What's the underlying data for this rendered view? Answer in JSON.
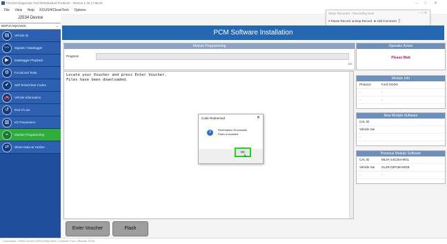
{
  "window": {
    "title": "KOUSH Diagnostic Tool Refurbished Products - Version 1.45.17.88.01"
  },
  "menu": [
    "File",
    "View",
    "Help",
    "KOUSH/CleanTech",
    "Options"
  ],
  "steps_recorder": {
    "title": "Steps Recorder - Recording Now",
    "pause": "Pause Record",
    "stop": "Stop Record",
    "add_comment": "Add Comment"
  },
  "sidebar": {
    "device_title": "J2534 Device",
    "device_select": "DDPort MyCANIC",
    "items": [
      {
        "label": "Vehicle ID",
        "icon": "vehicle-id-icon",
        "glyph": "▤"
      },
      {
        "label": "Signals / Datalogger",
        "icon": "signals-icon",
        "glyph": "〰"
      },
      {
        "label": "Datalogger Playback",
        "icon": "playback-icon",
        "glyph": "▶"
      },
      {
        "label": "Functional Tests",
        "icon": "functional-tests-icon",
        "glyph": "⚙"
      },
      {
        "label": "Self Tests/Clear Codes",
        "icon": "self-tests-icon",
        "glyph": "✔"
      },
      {
        "label": "Vehicle Information",
        "icon": "vehicle-info-icon",
        "glyph": "🚗"
      },
      {
        "label": "End of Line",
        "icon": "end-of-line-icon",
        "glyph": "↺"
      },
      {
        "label": "I/O Parameters",
        "icon": "io-parameters-icon",
        "glyph": "▥"
      },
      {
        "label": "Module Programming",
        "icon": "module-programming-icon",
        "glyph": "⌁",
        "active": true
      },
      {
        "label": "Share Data w/ Hotline",
        "icon": "share-data-icon",
        "glyph": "⇄"
      }
    ]
  },
  "header": {
    "title": "PCM Software Installation"
  },
  "module_programming": {
    "title": "Module Programming",
    "progress_label": "Progress",
    "progress_value": 0,
    "progress_text": "0/0"
  },
  "console": {
    "text": "Locate your Voucher and press Enter Voucher.\nFiles have been downloaded."
  },
  "buttons": {
    "enter_voucher": "Enter Voucher",
    "flash": "Flash"
  },
  "operator_action": {
    "title": "Operator Action",
    "status": "Please Wait"
  },
  "module_info": {
    "title": "Module Info",
    "rows": [
      {
        "key": "Protocol",
        "value": "Ford GGDS"
      },
      {
        "key": "-",
        "value": "-"
      },
      {
        "key": "-",
        "value": "-"
      }
    ]
  },
  "new_module_software": {
    "title": "New Module Software",
    "rows": [
      {
        "key": "CAL ID",
        "value": ""
      },
      {
        "key": "Vehicle Sw",
        "value": ""
      },
      {
        "key": "-",
        "value": ""
      }
    ]
  },
  "previous_module_software": {
    "title": "Previous Module Software",
    "rows": [
      {
        "key": "CAL ID",
        "value": "ML3A-14C204-MGL"
      },
      {
        "key": "Vehicle Sw",
        "value": "GL2R-03P150-MGB"
      },
      {
        "key": "-",
        "value": "-"
      }
    ]
  },
  "dialog": {
    "title": "Code Redeemed",
    "close": "✕",
    "message_line1": "Redemption Successful",
    "message_line2": "Flash is enabled",
    "ok": "OK"
  },
  "statusbar": {
    "text": "Connected: J2534 Device DDPort MyCANIC  |  Vehicle: Ford  |  Module: PCM"
  },
  "colors": {
    "sidebar": "#1f4f9c",
    "header": "#2468b4",
    "active_item": "#2fae3a",
    "please_wait": "#b0187a",
    "ok_highlight": "#1fd31f"
  }
}
